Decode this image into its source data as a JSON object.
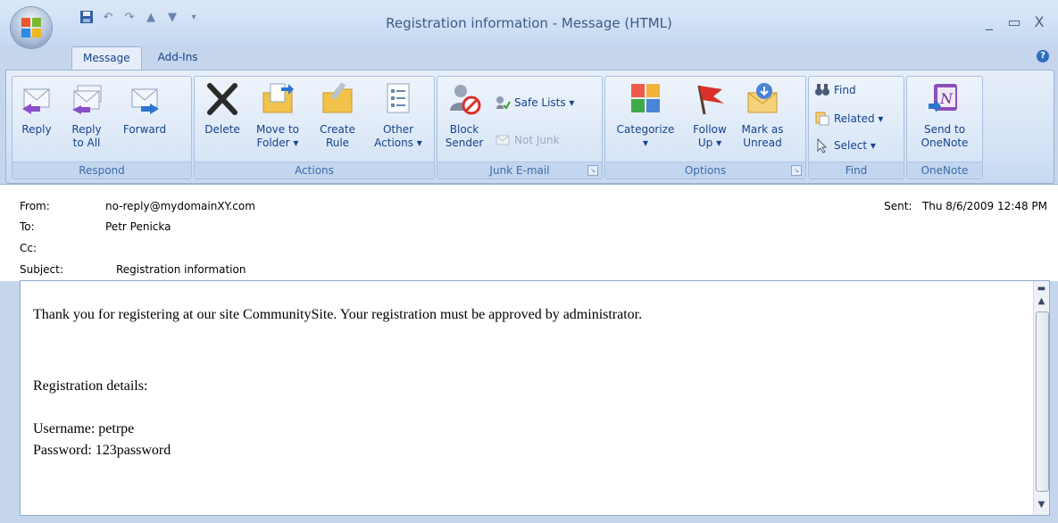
{
  "window": {
    "title": "Registration information - Message (HTML)",
    "controls": [
      "_",
      "▭",
      "X"
    ]
  },
  "tabs": [
    {
      "label": "Message",
      "active": true
    },
    {
      "label": "Add-Ins",
      "active": false
    }
  ],
  "ribbon": {
    "respond": {
      "group_label": "Respond",
      "reply": "Reply",
      "reply_all_1": "Reply",
      "reply_all_2": "to All",
      "forward": "Forward"
    },
    "actions": {
      "group_label": "Actions",
      "delete": "Delete",
      "move_1": "Move to",
      "move_2": "Folder ▾",
      "create_1": "Create",
      "create_2": "Rule",
      "other_1": "Other",
      "other_2": "Actions ▾"
    },
    "junk": {
      "group_label": "Junk E-mail",
      "block_1": "Block",
      "block_2": "Sender",
      "safe_lists": "Safe Lists ▾",
      "not_junk": "Not Junk"
    },
    "options": {
      "group_label": "Options",
      "categorize_1": "Categorize",
      "categorize_2": "▾",
      "follow_1": "Follow",
      "follow_2": "Up ▾",
      "mark_1": "Mark as",
      "mark_2": "Unread"
    },
    "find": {
      "group_label": "Find",
      "find": "Find",
      "related": "Related ▾",
      "select": "Select ▾"
    },
    "onenote": {
      "group_label": "OneNote",
      "send_1": "Send to",
      "send_2": "OneNote"
    }
  },
  "header": {
    "from_label": "From:",
    "from_value": "no-reply@mydomainXY.com",
    "to_label": "To:",
    "to_value": "Petr Penicka",
    "cc_label": "Cc:",
    "subject_label": "Subject:",
    "subject_value": "Registration information",
    "sent_label": "Sent:",
    "sent_value": "Thu 8/6/2009 12:48 PM"
  },
  "body": {
    "line1": "Thank you for registering at our site CommunitySite. Your registration must be approved by administrator.",
    "line2": "Registration details:",
    "line3": "Username: petrpe",
    "line4": "Password: 123password"
  }
}
